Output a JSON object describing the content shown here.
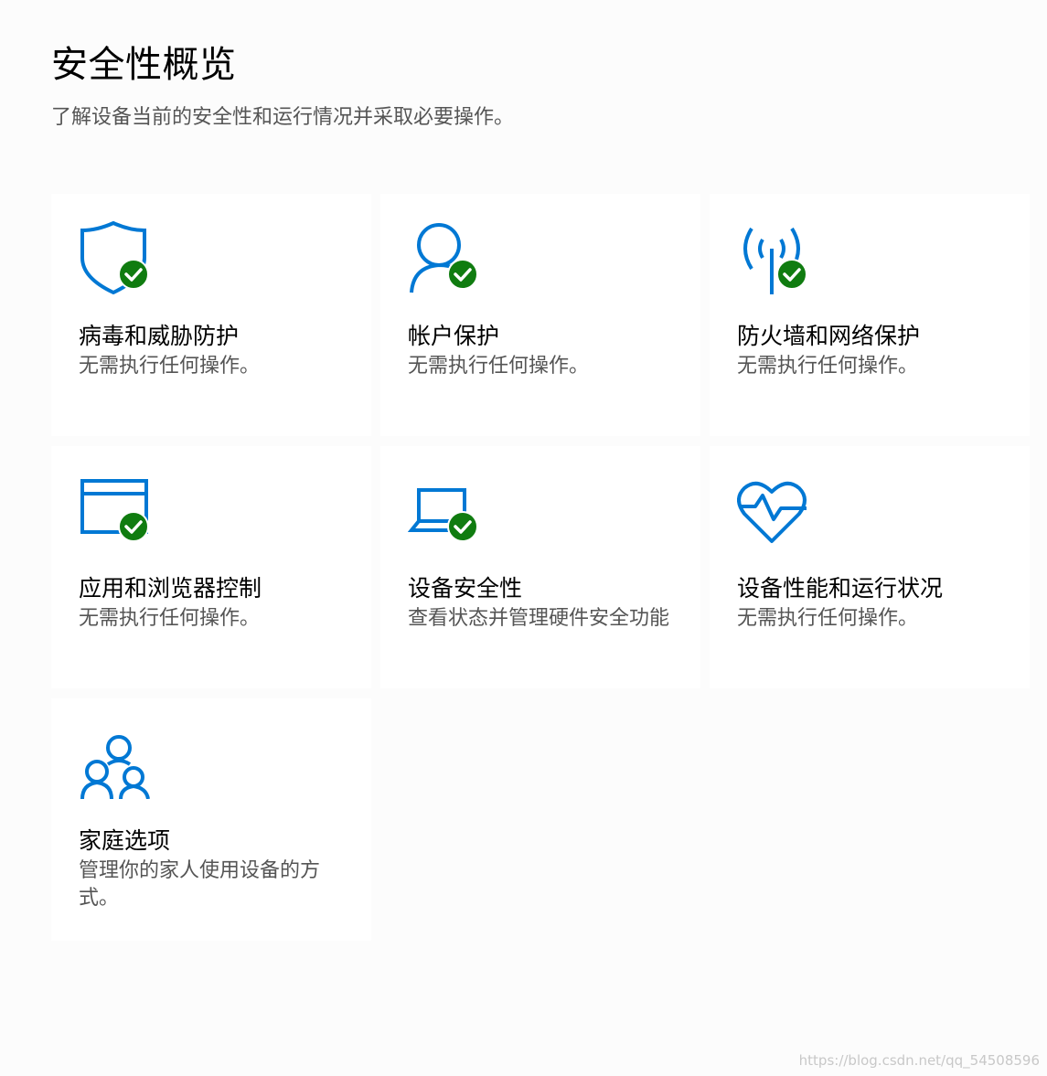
{
  "header": {
    "title": "安全性概览",
    "subtitle": "了解设备当前的安全性和运行情况并采取必要操作。"
  },
  "colors": {
    "accent": "#0078d4",
    "status_ok": "#107c10"
  },
  "cards": [
    {
      "title": "病毒和威胁防护",
      "desc": "无需执行任何操作。",
      "icon": "shield-icon",
      "status": "ok"
    },
    {
      "title": "帐户保护",
      "desc": "无需执行任何操作。",
      "icon": "person-icon",
      "status": "ok"
    },
    {
      "title": "防火墙和网络保护",
      "desc": "无需执行任何操作。",
      "icon": "antenna-icon",
      "status": "ok"
    },
    {
      "title": "应用和浏览器控制",
      "desc": "无需执行任何操作。",
      "icon": "browser-window-icon",
      "status": "ok"
    },
    {
      "title": "设备安全性",
      "desc": "查看状态并管理硬件安全功能",
      "icon": "laptop-icon",
      "status": "ok"
    },
    {
      "title": "设备性能和运行状况",
      "desc": "无需执行任何操作。",
      "icon": "heart-pulse-icon",
      "status": "none"
    },
    {
      "title": "家庭选项",
      "desc": "管理你的家人使用设备的方式。",
      "icon": "family-icon",
      "status": "none"
    }
  ],
  "watermark": "https://blog.csdn.net/qq_54508596"
}
